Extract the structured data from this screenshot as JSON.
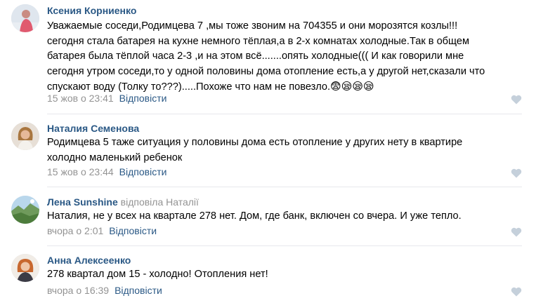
{
  "comments": [
    {
      "author": "Ксения Корниенко",
      "text_lines": [
        "Уважаемые соседи,Родимцева 7 ,мы тоже звоним на 704355 и они морозятся козлы!!!",
        "сегодня стала батарея на кухне немного тёплая,а в 2-х комнатах холодные.Так в общем",
        "батарея была тёплой часа 2-3 ,и на этом всё.......опять холодные((( И как говорили мне",
        "сегодня утром соседи,то у одной половины дома отопление есть,а у другой нет,сказали что",
        "спускают воду (Толку то???).....Похоже что нам не повезло."
      ],
      "emojis": "😨😪😪😪",
      "time": "15 жов о 23:41",
      "reply_label": "Відповісти"
    },
    {
      "author": "Наталия Семенова",
      "text_lines": [
        "Родимцева 5 таже ситуация у половины дома есть отопление у других нету в квартире",
        "холодно маленький ребенок"
      ],
      "time": "15 жов о 23:44",
      "reply_label": "Відповісти"
    },
    {
      "author": "Лена Sunshine",
      "reply_prefix": "відповіла",
      "reply_to": "Наталії",
      "text_lines": [
        "Наталия, не у всех на квартале 278 нет. Дом, где банк, включен со вчера. И уже тепло."
      ],
      "time": "вчора о 2:01",
      "reply_label": "Відповісти"
    },
    {
      "author": "Анна Алексеенко",
      "text_lines": [
        "278 квартал дом 15 - холодно! Отопления нет!"
      ],
      "time": "вчора о 16:39",
      "reply_label": "Відповісти"
    }
  ],
  "colors": {
    "author": "#2a5885",
    "meta": "#939393",
    "like_icon": "#c5d0db",
    "divider": "#e7e8ec"
  },
  "icons": {
    "like": "heart-icon"
  }
}
